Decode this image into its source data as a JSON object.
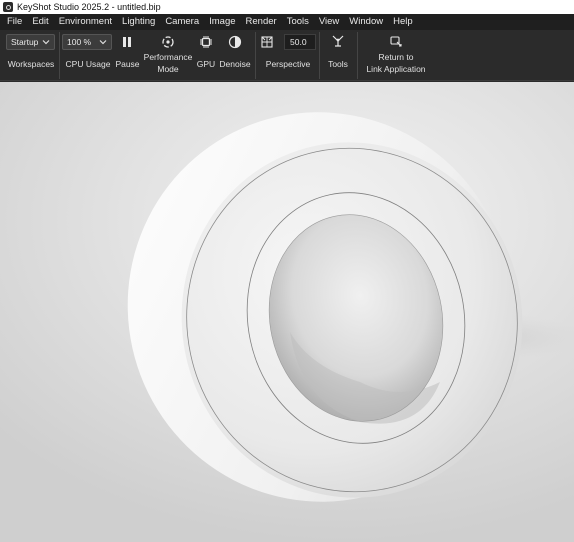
{
  "window": {
    "title": "KeyShot Studio 2025.2  - untitled.bip"
  },
  "menu": [
    "File",
    "Edit",
    "Environment",
    "Lighting",
    "Camera",
    "Image",
    "Render",
    "Tools",
    "View",
    "Window",
    "Help"
  ],
  "toolbar": {
    "workspace_value": "Startup",
    "workspaces_label": "Workspaces",
    "cpu_value": "100 %",
    "cpu_label": "CPU Usage",
    "pause_label": "Pause",
    "performance_label_1": "Performance",
    "performance_label_2": "Mode",
    "gpu_label": "GPU",
    "denoise_label": "Denoise",
    "perspective_value": "50.0",
    "perspective_label": "Perspective",
    "tools_label": "Tools",
    "return_label_1": "Return to",
    "return_label_2": "Link Application"
  },
  "icons": {
    "app": "keyshot-app-icon",
    "pause": "pause-icon",
    "performance": "performance-mode-icon",
    "gpu": "gpu-chip-icon",
    "denoise": "denoise-icon",
    "perspective": "camera-perspective-icon",
    "tools": "tools-icon",
    "return": "return-link-icon"
  },
  "colors": {
    "toolbar_bg": "#2b2b2b",
    "menubar_bg": "#1f1f1f",
    "viewport_bg": "#e3e3e3",
    "model": "#f0f0f0"
  }
}
